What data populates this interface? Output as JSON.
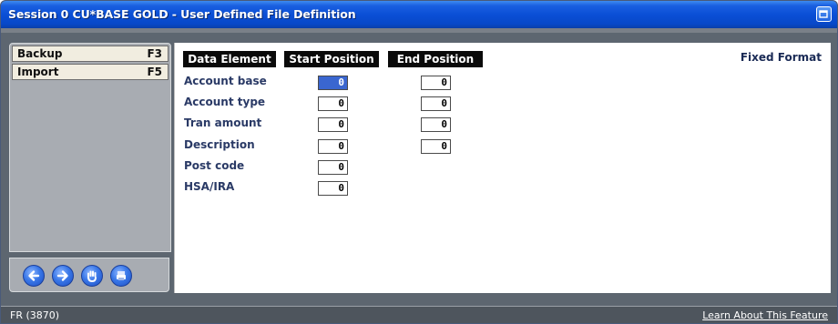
{
  "window": {
    "title": "Session 0 CU*BASE GOLD - User Defined File Definition",
    "title_button_icon": "restore-icon"
  },
  "sidebar": {
    "items": [
      {
        "label": "Backup",
        "key": "F3"
      },
      {
        "label": "Import",
        "key": "F5"
      }
    ]
  },
  "nav_buttons": [
    {
      "icon": "back-arrow-icon"
    },
    {
      "icon": "forward-arrow-icon"
    },
    {
      "icon": "stop-hand-icon"
    },
    {
      "icon": "print-icon"
    }
  ],
  "table": {
    "headers": [
      "Data Element",
      "Start Position",
      "End Position"
    ],
    "format_label": "Fixed Format",
    "rows": [
      {
        "label": "Account base",
        "start": "0",
        "end": "0"
      },
      {
        "label": "Account type",
        "start": "0",
        "end": "0"
      },
      {
        "label": "Tran amount",
        "start": "0",
        "end": "0"
      },
      {
        "label": "Description",
        "start": "0",
        "end": "0"
      },
      {
        "label": "Post code",
        "start": "0"
      },
      {
        "label": "HSA/IRA",
        "start": "0"
      }
    ]
  },
  "status": {
    "screen_id": "FR (3870)",
    "learn_link": "Learn About This Feature"
  },
  "colors": {
    "title_blue": "#0a4fd6",
    "frame_gray": "#5d6670",
    "selected_field": "#3a66d0"
  }
}
